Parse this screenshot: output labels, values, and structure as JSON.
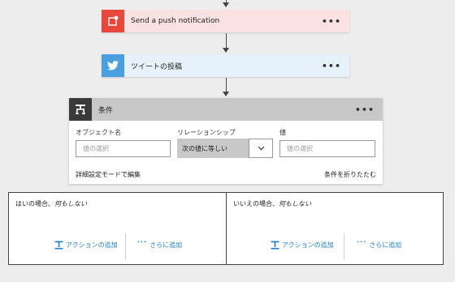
{
  "flow": {
    "push_step": {
      "label": "Send a push notification",
      "more": "•••"
    },
    "tweet_step": {
      "label": "ツイートの投稿",
      "more": "•••"
    },
    "condition": {
      "title": "条件",
      "more": "•••",
      "object_label": "オブジェクト名",
      "object_placeholder": "値の選択",
      "relation_label": "リレーションシップ",
      "relation_value": "次の値に等しい",
      "value_label": "値",
      "value_placeholder": "値の選択",
      "advanced_link": "詳細設定モードで編集",
      "collapse_link": "条件を折りたたむ"
    },
    "yes_branch": {
      "title_prefix": "はいの場合、",
      "title_action": "何もしない",
      "add_action": "アクションの追加",
      "add_more": "さらに追加"
    },
    "no_branch": {
      "title_prefix": "いいえの場合、",
      "title_action": "何もしない",
      "add_action": "アクションの追加",
      "add_more": "さらに追加"
    }
  },
  "colors": {
    "push_accent": "#e8473c",
    "twitter_accent": "#4a9fe0",
    "condition_header": "#c8c8c8",
    "link_blue": "#1e7fc9"
  }
}
